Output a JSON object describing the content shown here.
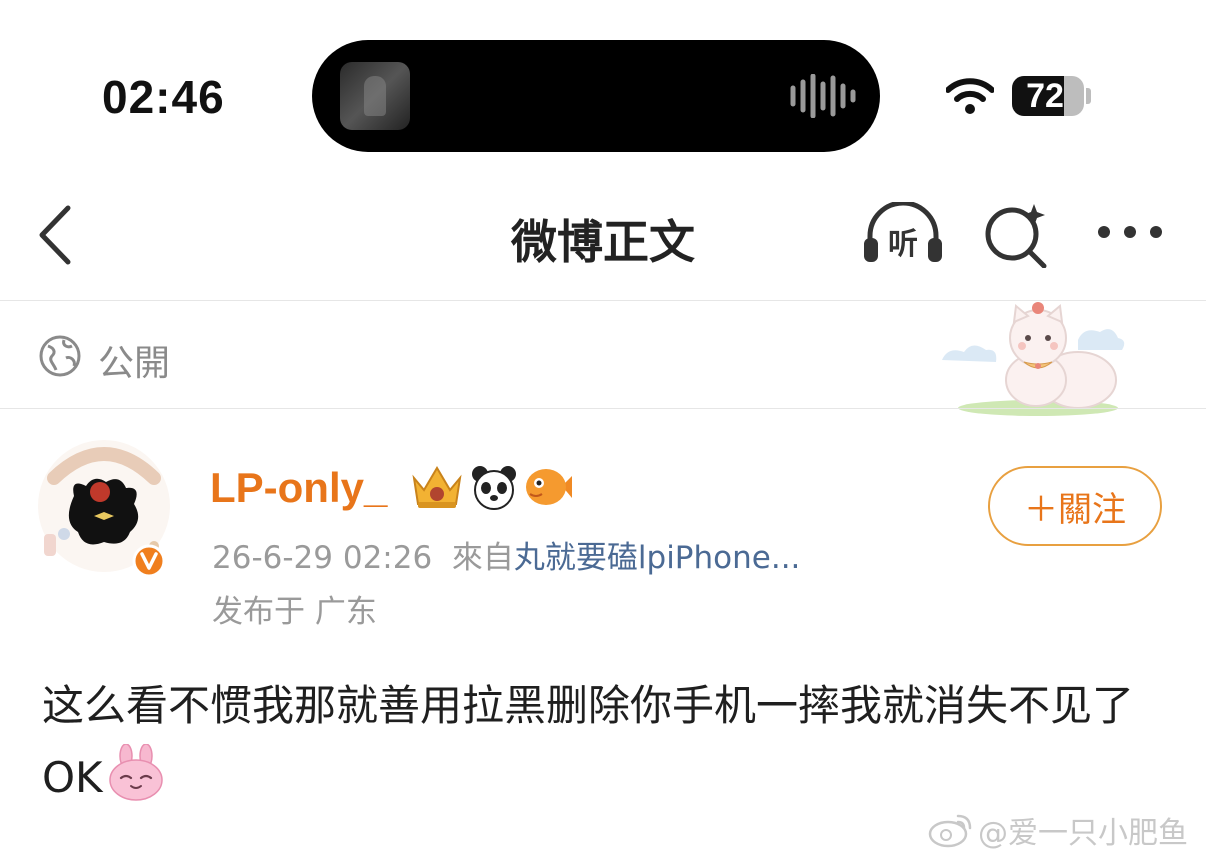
{
  "status_bar": {
    "time": "02:46",
    "battery": 72
  },
  "nav": {
    "title": "微博正文",
    "listen_label": "听"
  },
  "visibility": {
    "label": "公開"
  },
  "author": {
    "name": "LP-only_"
  },
  "follow": {
    "label": "＋關注"
  },
  "post": {
    "date": "26-6-29 02:26",
    "from_label": "來自",
    "source": "丸就要磕lpiPhone...",
    "location": "发布于 广东",
    "text": "这么看不惯我那就善用拉黑删除你手机一摔我就消失不见了OK"
  },
  "watermark": "@爱一只小肥鱼",
  "colors": {
    "accent": "#e8751a",
    "link": "#4b6a94",
    "muted": "#9a9a9a"
  }
}
